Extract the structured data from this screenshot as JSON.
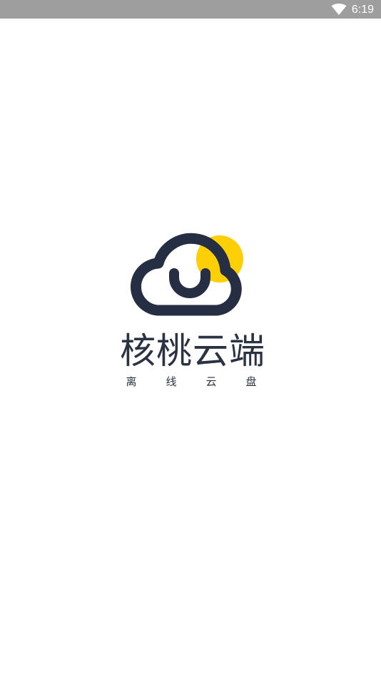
{
  "status_bar": {
    "time": "6:19",
    "wifi_icon": "wifi-icon",
    "color": "#9e9e9e"
  },
  "splash": {
    "logo_icon": "cloud-smile-sun-logo",
    "app_name": "核桃云端",
    "tagline_chars": [
      "离",
      "线",
      "云",
      "盘"
    ],
    "colors": {
      "brand_dark": "#252e42",
      "sun_yellow": "#fccf07",
      "background": "#ffffff"
    }
  }
}
